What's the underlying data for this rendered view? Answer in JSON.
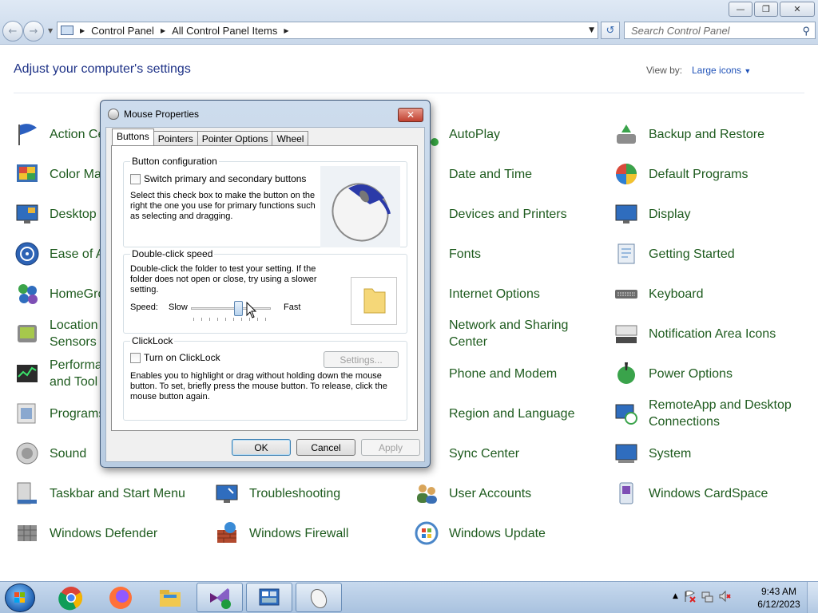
{
  "window": {
    "breadcrumb": [
      "Control Panel",
      "All Control Panel Items"
    ],
    "search_placeholder": "Search Control Panel",
    "buttons": {
      "minimize": "minimize-icon",
      "maximize": "restore-icon",
      "close": "close-icon"
    }
  },
  "main": {
    "heading": "Adjust your computer's settings",
    "view_by_label": "View by:",
    "view_by_value": "Large icons"
  },
  "items": {
    "col1": [
      "Action Ce",
      "Color Ma",
      "Desktop G",
      "Ease of A",
      "HomeGro",
      "Location\nSensors",
      "Performa\nand Tool",
      "Programs",
      "Sound",
      "Taskbar and Start Menu",
      "Windows Defender"
    ],
    "col2": [
      "Troubleshooting",
      "Windows Firewall"
    ],
    "col3": [
      "AutoPlay",
      "Date and Time",
      "Devices and Printers",
      "Fonts",
      "Internet Options",
      "Network and Sharing\nCenter",
      "Phone and Modem",
      "Region and Language",
      "Sync Center",
      "User Accounts",
      "Windows Update"
    ],
    "col4": [
      "Backup and Restore",
      "Default Programs",
      "Display",
      "Getting Started",
      "Keyboard",
      "Notification Area Icons",
      "Power Options",
      "RemoteApp and Desktop\nConnections",
      "System",
      "Windows CardSpace"
    ]
  },
  "dialog": {
    "title": "Mouse Properties",
    "tabs": [
      "Buttons",
      "Pointers",
      "Pointer Options",
      "Wheel"
    ],
    "active_tab": "Buttons",
    "button_config": {
      "title": "Button configuration",
      "checkbox_label": "Switch primary and secondary buttons",
      "checked": false,
      "description": "Select this check box to make the button on the right the one you use for primary functions such as selecting and dragging."
    },
    "double_click": {
      "title": "Double-click speed",
      "description": "Double-click the folder to test your setting. If the folder does not open or close, try using a slower setting.",
      "speed_label": "Speed:",
      "slow_label": "Slow",
      "fast_label": "Fast",
      "slider_value_fraction": 0.6
    },
    "clicklock": {
      "title": "ClickLock",
      "checkbox_label": "Turn on ClickLock",
      "checked": false,
      "settings_button": "Settings...",
      "description": "Enables you to highlight or drag without holding down the mouse button. To set, briefly press the mouse button. To release, click the mouse button again."
    },
    "buttons": {
      "ok": "OK",
      "cancel": "Cancel",
      "apply": "Apply"
    }
  },
  "taskbar": {
    "apps": [
      "chrome-icon",
      "firefox-icon",
      "explorer-icon",
      "visual-studio-icon",
      "control-panel-icon",
      "mouse-icon"
    ],
    "time": "9:43 AM",
    "date": "6/12/2023"
  },
  "colors": {
    "link_green": "#1e5b1e",
    "heading_blue": "#1e3287",
    "view_by_blue": "#1e51b8"
  }
}
